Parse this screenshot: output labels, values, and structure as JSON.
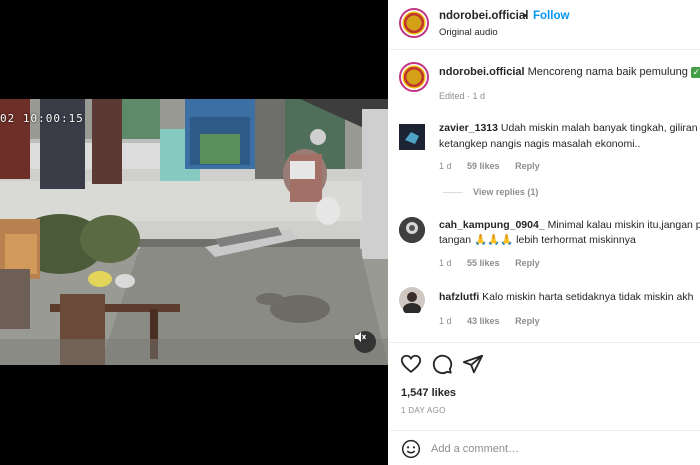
{
  "video": {
    "timestamp": "02 10:00:15",
    "sound_icon": "speaker-muted-icon"
  },
  "header": {
    "username": "ndorobei.official",
    "separator": "•",
    "follow_label": "Follow",
    "audio_label": "Original audio"
  },
  "caption": {
    "username": "ndorobei.official",
    "text": "Mencoreng nama baik pemulung",
    "emoji": "✓",
    "meta": "Edited · 1 d"
  },
  "comments": [
    {
      "username": "zavier_1313",
      "line1": "Udah miskin malah banyak tingkah, giliran",
      "line2": "ketangkep nangis nagis masalah ekonomi..",
      "time": "1 d",
      "likes": "59 likes",
      "reply": "Reply"
    },
    {
      "username": "cah_kampung_0904_",
      "line1": "Minimal kalau miskin itu,jangan p",
      "line2": "tangan 🙏🙏🙏 lebih terhormat miskinnya",
      "time": "1 d",
      "likes": "55 likes",
      "reply": "Reply"
    },
    {
      "username": "hafzlutfi",
      "line1": "Kalo miskin harta setidaknya tidak miskin akh",
      "line2": "",
      "time": "1 d",
      "likes": "43 likes",
      "reply": "Reply"
    }
  ],
  "view_replies": "View replies (1)",
  "actions": {
    "icons": [
      "heart-icon",
      "comment-icon",
      "share-icon"
    ],
    "likes": "1,547 likes",
    "posted": "1 DAY AGO"
  },
  "composer": {
    "placeholder": "Add a comment…"
  },
  "colors": {
    "link_blue": "#0095f6",
    "muted": "#8e8e8e",
    "text": "#262626",
    "check_green": "#43a047"
  }
}
